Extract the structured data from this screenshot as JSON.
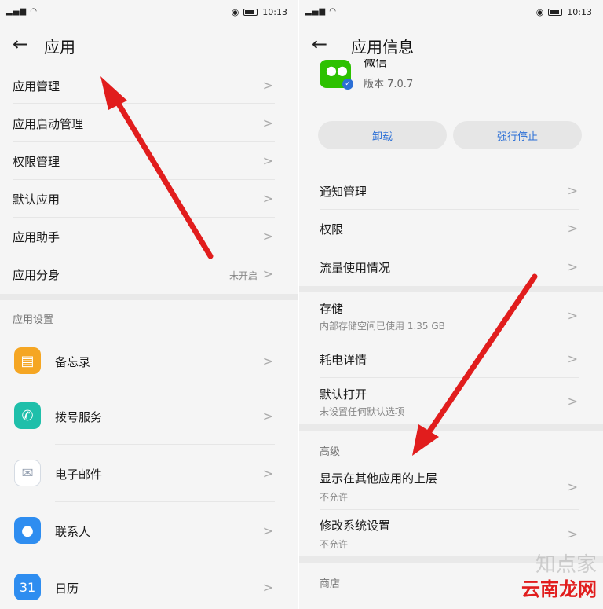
{
  "left": {
    "status_time": "10:13",
    "title": "应用",
    "menu": [
      {
        "label": "应用管理"
      },
      {
        "label": "应用启动管理"
      },
      {
        "label": "权限管理"
      },
      {
        "label": "默认应用"
      },
      {
        "label": "应用助手"
      },
      {
        "label": "应用分身",
        "value": "未开启"
      }
    ],
    "section_title": "应用设置",
    "apps": [
      {
        "label": "备忘录",
        "icon": "notes-icon",
        "color": "#f5a623"
      },
      {
        "label": "拨号服务",
        "icon": "phone-icon",
        "color": "#1fbfaa"
      },
      {
        "label": "电子邮件",
        "icon": "mail-icon",
        "color": "#cfd6e0"
      },
      {
        "label": "联系人",
        "icon": "contacts-icon",
        "color": "#2e8df0"
      },
      {
        "label": "日历",
        "icon_text": "31",
        "icon": "calendar-icon",
        "color": "#2e8df0"
      }
    ]
  },
  "right": {
    "status_time": "10:13",
    "title": "应用信息",
    "app_name": "微信",
    "app_version": "版本 7.0.7",
    "uninstall_label": "卸载",
    "force_stop_label": "强行停止",
    "items1": [
      {
        "label": "通知管理"
      },
      {
        "label": "权限"
      },
      {
        "label": "流量使用情况"
      }
    ],
    "items2": [
      {
        "label": "存储",
        "sub": "内部存储空间已使用 1.35 GB"
      },
      {
        "label": "耗电详情"
      },
      {
        "label": "默认打开",
        "sub": "未设置任何默认选项"
      }
    ],
    "advanced_title": "高级",
    "items3": [
      {
        "label": "显示在其他应用的上层",
        "sub": "不允许"
      },
      {
        "label": "修改系统设置",
        "sub": "不允许"
      }
    ],
    "store_title": "商店",
    "watermark_top": "知点家",
    "watermark_bottom": "云南龙网"
  },
  "colors": {
    "arrow": "#e11d1d",
    "accent": "#2b6fd6",
    "wechat": "#2dc100"
  }
}
